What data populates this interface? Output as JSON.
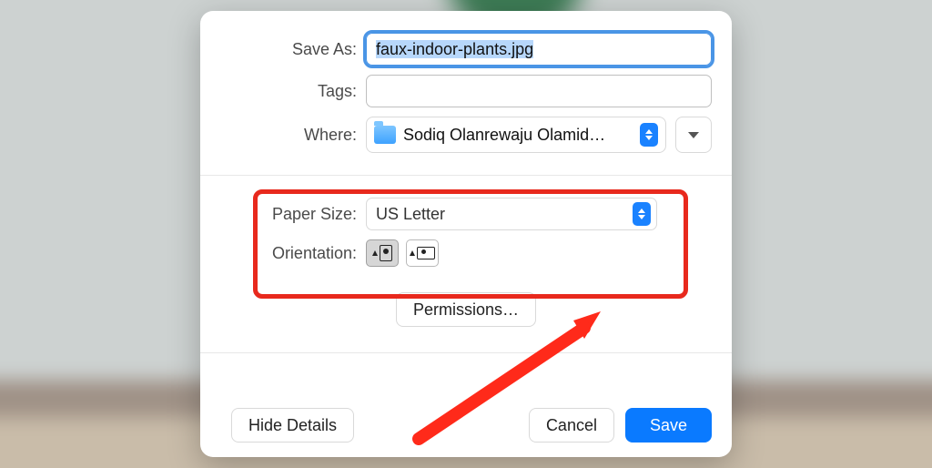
{
  "labels": {
    "save_as": "Save As:",
    "tags": "Tags:",
    "where": "Where:",
    "paper_size": "Paper Size:",
    "orientation": "Orientation:"
  },
  "inputs": {
    "filename": "faux-indoor-plants.jpg",
    "tags": "",
    "where_folder": "Sodiq Olanrewaju Olamid…",
    "paper_size": "US Letter"
  },
  "buttons": {
    "permissions": "Permissions…",
    "hide_details": "Hide Details",
    "cancel": "Cancel",
    "save": "Save"
  },
  "orientation": {
    "selected": "portrait"
  }
}
